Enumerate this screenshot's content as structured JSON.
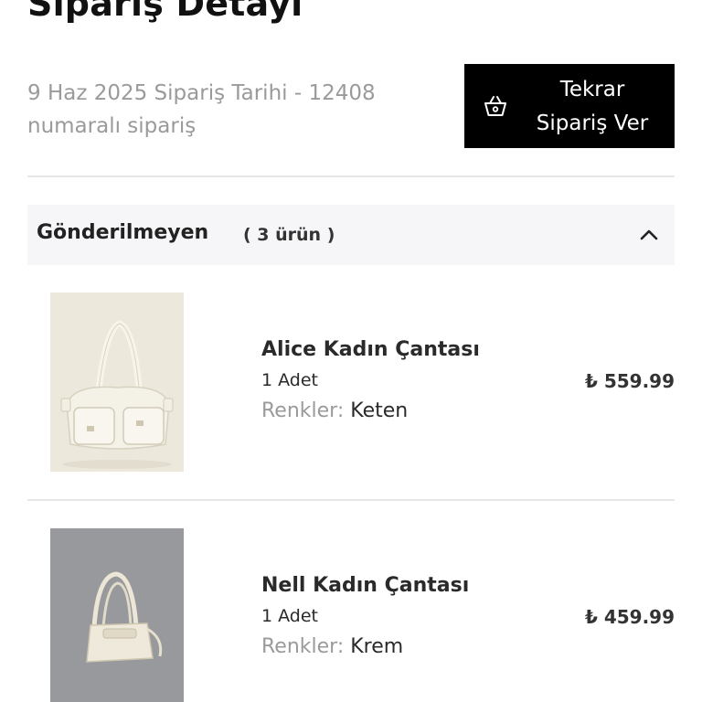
{
  "page": {
    "title": "Sipariş Detayı"
  },
  "order": {
    "meta_line1": "9 Haz 2025 Sipariş Tarihi - 12408",
    "meta_line2": "numaralı sipariş"
  },
  "reorder_button": {
    "line1": "Tekrar",
    "line2": "Sipariş Ver",
    "icon": "basket-icon"
  },
  "group": {
    "title": "Gönderilmeyen",
    "count": "( 3 ürün )",
    "toggle_icon": "chevron-up-icon"
  },
  "products": [
    {
      "name": "Alice Kadın Çantası",
      "quantity": "1 Adet",
      "color_label": "Renkler:",
      "color_value": "Keten",
      "price": "₺ 559.99",
      "image_bg": "#ece8dc"
    },
    {
      "name": "Nell Kadın Çantası",
      "quantity": "1 Adet",
      "color_label": "Renkler:",
      "color_value": "Krem",
      "price": "₺ 459.99",
      "image_bg": "#8f9294"
    }
  ],
  "colors": {
    "accent": "#000000",
    "muted_text": "#9a9a9a",
    "header_bg": "#f6f6f8"
  }
}
